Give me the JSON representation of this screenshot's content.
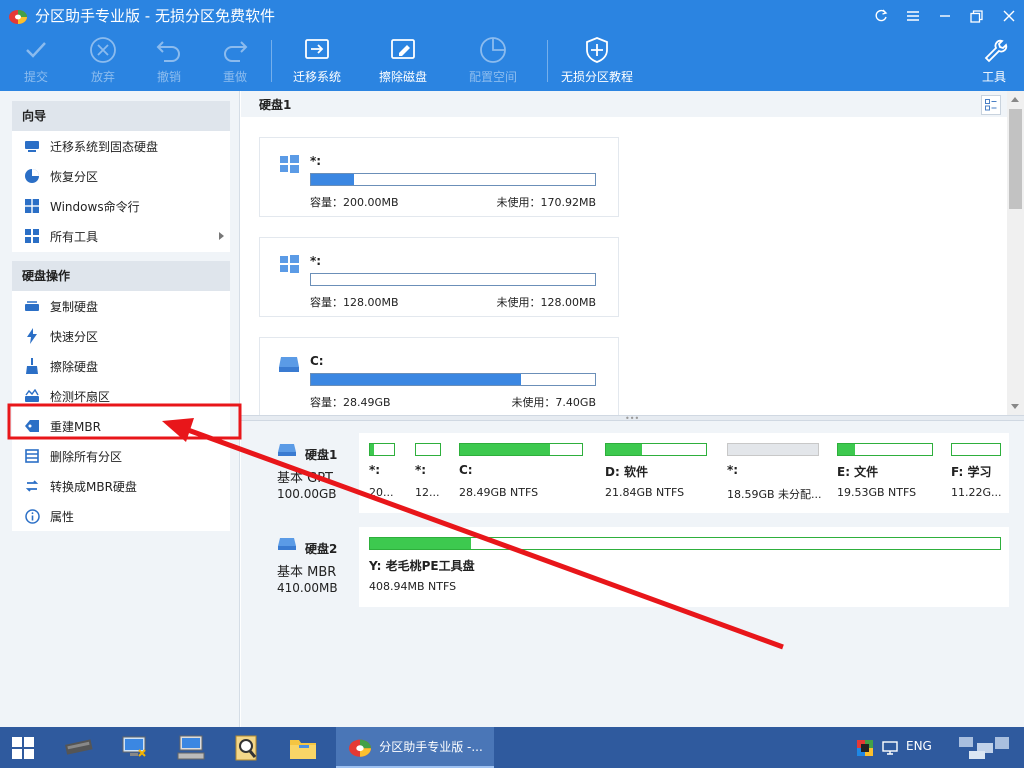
{
  "window": {
    "title": "分区助手专业版 - 无损分区免费软件"
  },
  "toolbar": {
    "buttons": [
      {
        "label": "提交",
        "icon": "check-icon",
        "enabled": false
      },
      {
        "label": "放弃",
        "icon": "cancel-icon",
        "enabled": false
      },
      {
        "label": "撤销",
        "icon": "undo-icon",
        "enabled": false
      },
      {
        "label": "重做",
        "icon": "redo-icon",
        "enabled": false
      },
      {
        "label": "迁移系统",
        "icon": "migrate-icon",
        "enabled": true
      },
      {
        "label": "擦除磁盘",
        "icon": "erase-disk-icon",
        "enabled": true
      },
      {
        "label": "配置空间",
        "icon": "allocate-space-icon",
        "enabled": false
      },
      {
        "label": "无损分区教程",
        "icon": "shield-icon",
        "enabled": true
      },
      {
        "label": "工具",
        "icon": "tools-icon",
        "enabled": true
      }
    ]
  },
  "sidebar": {
    "wizard": {
      "header": "向导",
      "items": [
        {
          "label": "迁移系统到固态硬盘",
          "icon": "migrate-ssd-icon"
        },
        {
          "label": "恢复分区",
          "icon": "recover-partition-icon"
        },
        {
          "label": "Windows命令行",
          "icon": "windows-icon"
        },
        {
          "label": "所有工具",
          "icon": "all-tools-icon",
          "submenu": true
        }
      ]
    },
    "disk_ops": {
      "header": "硬盘操作",
      "items": [
        {
          "label": "复制硬盘",
          "icon": "copy-disk-icon"
        },
        {
          "label": "快速分区",
          "icon": "lightning-icon"
        },
        {
          "label": "擦除硬盘",
          "icon": "broom-icon"
        },
        {
          "label": "检测坏扇区",
          "icon": "check-sector-icon"
        },
        {
          "label": "重建MBR",
          "icon": "tag-icon",
          "highlighted": true
        },
        {
          "label": "删除所有分区",
          "icon": "delete-partitions-icon"
        },
        {
          "label": "转换成MBR硬盘",
          "icon": "convert-icon"
        },
        {
          "label": "属性",
          "icon": "info-icon"
        }
      ]
    }
  },
  "upper": {
    "heading": "硬盘1",
    "cards": [
      {
        "name": "*:",
        "icon": "windows-icon",
        "capacity": "容量：200.00MB",
        "free": "未使用：170.92MB",
        "used_fraction": 0.15
      },
      {
        "name": "*:",
        "icon": "windows-icon",
        "capacity": "容量：128.00MB",
        "free": "未使用：128.00MB",
        "used_fraction": 0.0
      },
      {
        "name": "C:",
        "icon": "drive-icon",
        "capacity": "容量：28.49GB",
        "free": "未使用：7.40GB",
        "used_fraction": 0.74
      }
    ]
  },
  "disks": [
    {
      "name": "硬盘1",
      "type": "基本 GPT",
      "size": "100.00GB",
      "partitions": [
        {
          "name": "*:",
          "detail": "20...",
          "used_fraction": 0.15
        },
        {
          "name": "*:",
          "detail": "12...",
          "used_fraction": 0.0
        },
        {
          "name": "C:",
          "detail": "28.49GB NTFS",
          "used_fraction": 0.74
        },
        {
          "name": "D: 软件",
          "detail": "21.84GB NTFS",
          "used_fraction": 0.36
        },
        {
          "name": "*:",
          "detail": "18.59GB 未分配...",
          "unallocated": true
        },
        {
          "name": "E: 文件",
          "detail": "19.53GB NTFS",
          "used_fraction": 0.18
        },
        {
          "name": "F: 学习",
          "detail": "11.22G...",
          "used_fraction": 0.0
        }
      ]
    },
    {
      "name": "硬盘2",
      "type": "基本 MBR",
      "size": "410.00MB",
      "partitions": [
        {
          "name": "Y: 老毛桃PE工具盘",
          "detail": "408.94MB NTFS",
          "used_fraction": 0.16
        }
      ]
    }
  ],
  "taskbar": {
    "active_app_label": "分区助手专业版 -...",
    "language": "ENG"
  },
  "colors": {
    "titlebar": "#2b84e1",
    "accent_bar": "#3b87e2",
    "partition_green": "#3dc94f",
    "annotation_red": "#e8161a"
  }
}
